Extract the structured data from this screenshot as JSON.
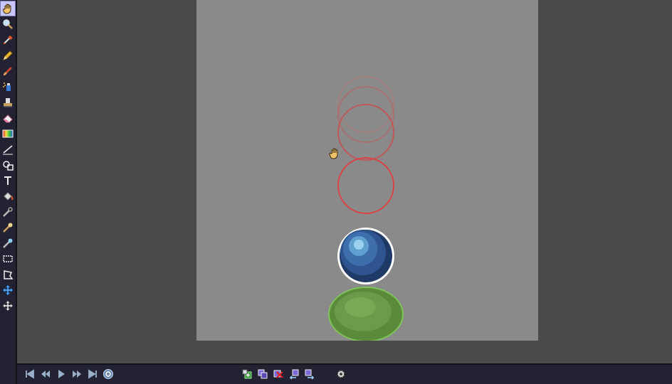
{
  "app": {
    "colors": {
      "toolbar_bg": "#222233",
      "workspace_bg": "#4a4a4a",
      "canvas_bg": "#8a8a8a",
      "onion_red": "#d84444",
      "blue_ball": "#3a6aa8",
      "green_blob": "#6a9a4a"
    }
  },
  "toolbar": {
    "tools": [
      {
        "icon": "hand-icon",
        "active": true
      },
      {
        "icon": "zoom-icon"
      },
      {
        "icon": "eyedropper-icon"
      },
      {
        "icon": "pencil-icon"
      },
      {
        "icon": "brush-icon"
      },
      {
        "icon": "spray-icon"
      },
      {
        "icon": "stamp-icon"
      },
      {
        "icon": "eraser-icon"
      },
      {
        "icon": "gradient-icon"
      },
      {
        "icon": "line-icon"
      },
      {
        "icon": "curve-icon"
      },
      {
        "icon": "text-icon"
      },
      {
        "icon": "paint-bucket-icon"
      },
      {
        "icon": "smudge-icon"
      },
      {
        "icon": "blur-icon"
      },
      {
        "icon": "jumble-icon"
      },
      {
        "icon": "rectangle-select-icon"
      },
      {
        "icon": "lasso-icon"
      },
      {
        "icon": "move-selection-icon"
      },
      {
        "icon": "move-icon"
      }
    ]
  },
  "timeline": {
    "playback": [
      {
        "icon": "first-frame-icon"
      },
      {
        "icon": "previous-frame-icon"
      },
      {
        "icon": "play-icon"
      },
      {
        "icon": "next-frame-icon"
      },
      {
        "icon": "last-frame-icon"
      },
      {
        "icon": "loop-icon"
      }
    ],
    "frame_ops": [
      {
        "icon": "add-frame-icon"
      },
      {
        "icon": "duplicate-frame-icon"
      },
      {
        "icon": "delete-frame-icon"
      },
      {
        "icon": "move-frame-left-icon"
      },
      {
        "icon": "move-frame-right-icon"
      }
    ],
    "settings": {
      "icon": "onion-skin-settings-icon"
    }
  },
  "canvas": {
    "layers": [
      "onion-skin-frames",
      "blue-ball",
      "green-blob"
    ]
  }
}
